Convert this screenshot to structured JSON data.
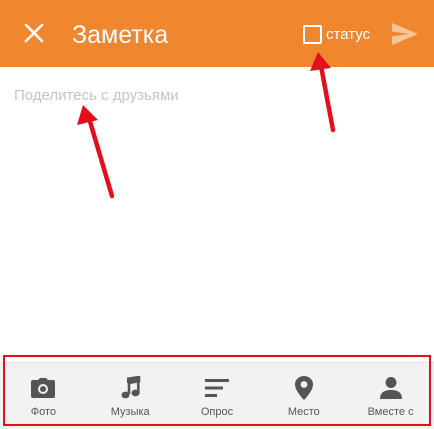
{
  "colors": {
    "accent": "#F0872F",
    "toolbar_bg": "#f2f2f2",
    "annotation": "#E3101C"
  },
  "header": {
    "close_icon": "close-icon",
    "title": "Заметка",
    "status_label": "статус",
    "status_checked": false,
    "send_icon": "send-icon"
  },
  "editor": {
    "value": "",
    "placeholder": "Поделитесь с друзьями"
  },
  "toolbar": {
    "items": [
      {
        "icon": "camera-icon",
        "label": "Фото"
      },
      {
        "icon": "music-note-icon",
        "label": "Музыка"
      },
      {
        "icon": "poll-icon",
        "label": "Опрос"
      },
      {
        "icon": "location-pin-icon",
        "label": "Место"
      },
      {
        "icon": "person-icon",
        "label": "Вместе с"
      }
    ]
  }
}
